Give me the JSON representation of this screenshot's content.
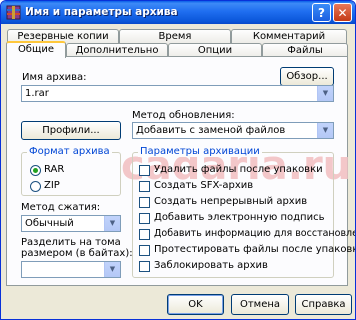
{
  "window": {
    "title": "Имя и параметры архива",
    "help_label": "?",
    "close_label": "✕"
  },
  "watermark": "cadaria.ru",
  "tabs": {
    "row_back": [
      "Резервные копии",
      "Время",
      "Комментарий"
    ],
    "row_front": [
      "Общие",
      "Дополнительно",
      "Опции",
      "Файлы"
    ],
    "active": "Общие"
  },
  "archive": {
    "name_label": "Имя архива:",
    "name_value": "1.rar",
    "browse_button": "Обзор..."
  },
  "update": {
    "label": "Метод обновления:",
    "value": "Добавить с заменой файлов"
  },
  "profiles_button": "Профили...",
  "format": {
    "group_title": "Формат архива",
    "options": [
      "RAR",
      "ZIP"
    ],
    "selected": "RAR"
  },
  "compression": {
    "label": "Метод сжатия:",
    "value": "Обычный"
  },
  "split": {
    "label_line1": "Разделить на тома",
    "label_line2": "размером (в байтах):",
    "value": ""
  },
  "params": {
    "group_title": "Параметры архивации",
    "options": [
      {
        "label": "Удалить файлы после упаковки",
        "checked": false
      },
      {
        "label": "Создать SFX-архив",
        "checked": false
      },
      {
        "label": "Создать непрерывный архив",
        "checked": false
      },
      {
        "label": "Добавить электронную подпись",
        "checked": false
      },
      {
        "label": "Добавить информацию для восстановления",
        "checked": false
      },
      {
        "label": "Протестировать файлы после упаковки",
        "checked": false
      },
      {
        "label": "Заблокировать архив",
        "checked": false
      }
    ]
  },
  "buttons": {
    "ok": "OK",
    "cancel": "Отмена",
    "help": "Справка"
  },
  "colors": {
    "titlebar": "#0a55d8",
    "dialog_bg": "#ece9d8",
    "active_tab_accent": "#ffc83c",
    "radio_dot": "#21a121",
    "watermark": "#f3c7c9"
  }
}
